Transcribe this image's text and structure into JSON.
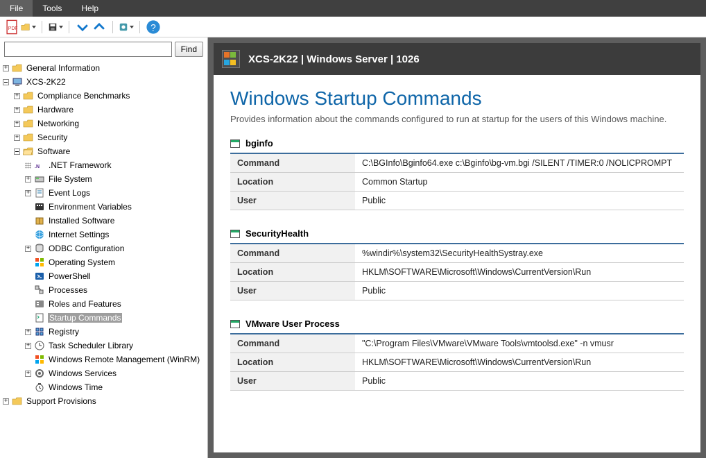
{
  "menu": {
    "file": "File",
    "tools": "Tools",
    "help": "Help"
  },
  "toolbar": {
    "pdf_tip": "Export PDF",
    "open_folder_tip": "Open",
    "save_tip": "Save",
    "collapse_tip": "Collapse",
    "expand_tip": "Expand",
    "refresh_tip": "Refresh",
    "settings_tip": "Settings",
    "help_tip": "Help"
  },
  "search": {
    "placeholder": "",
    "button": "Find"
  },
  "tree": {
    "root_general": "General Information",
    "root_host": "XCS-2K22",
    "host_children": {
      "compliance": "Compliance Benchmarks",
      "hardware": "Hardware",
      "networking": "Networking",
      "security": "Security",
      "software": "Software"
    },
    "software_children": {
      "dotnet": ".NET Framework",
      "filesystem": "File System",
      "eventlogs": "Event Logs",
      "envvars": "Environment Variables",
      "installed": "Installed Software",
      "internet": "Internet Settings",
      "odbc": "ODBC Configuration",
      "os": "Operating System",
      "powershell": "PowerShell",
      "processes": "Processes",
      "roles": "Roles and Features",
      "startup": "Startup Commands",
      "registry": "Registry",
      "tasksched": "Task Scheduler Library",
      "winrm": "Windows Remote Management (WinRM)",
      "winservices": "Windows Services",
      "wintime": "Windows Time"
    },
    "root_support": "Support Provisions"
  },
  "page": {
    "header_logo_colors": [
      "#e57328",
      "#7bba3c",
      "#27a6e0",
      "#f4bf22"
    ],
    "header_title": "XCS-2K22 | Windows Server | 1026",
    "h1": "Windows Startup Commands",
    "desc": "Provides information about the commands configured to run at startup for the users of this Windows machine.",
    "row_labels": {
      "command": "Command",
      "location": "Location",
      "user": "User"
    },
    "sections": [
      {
        "name": "bginfo",
        "command": "C:\\BGInfo\\Bginfo64.exe c:\\Bginfo\\bg-vm.bgi /SILENT /TIMER:0 /NOLICPROMPT",
        "location": "Common Startup",
        "user": "Public"
      },
      {
        "name": "SecurityHealth",
        "command": "%windir%\\system32\\SecurityHealthSystray.exe",
        "location": "HKLM\\SOFTWARE\\Microsoft\\Windows\\CurrentVersion\\Run",
        "user": "Public"
      },
      {
        "name": "VMware User Process",
        "command": "\"C:\\Program Files\\VMware\\VMware Tools\\vmtoolsd.exe\" -n vmusr",
        "location": "HKLM\\SOFTWARE\\Microsoft\\Windows\\CurrentVersion\\Run",
        "user": "Public"
      }
    ]
  }
}
